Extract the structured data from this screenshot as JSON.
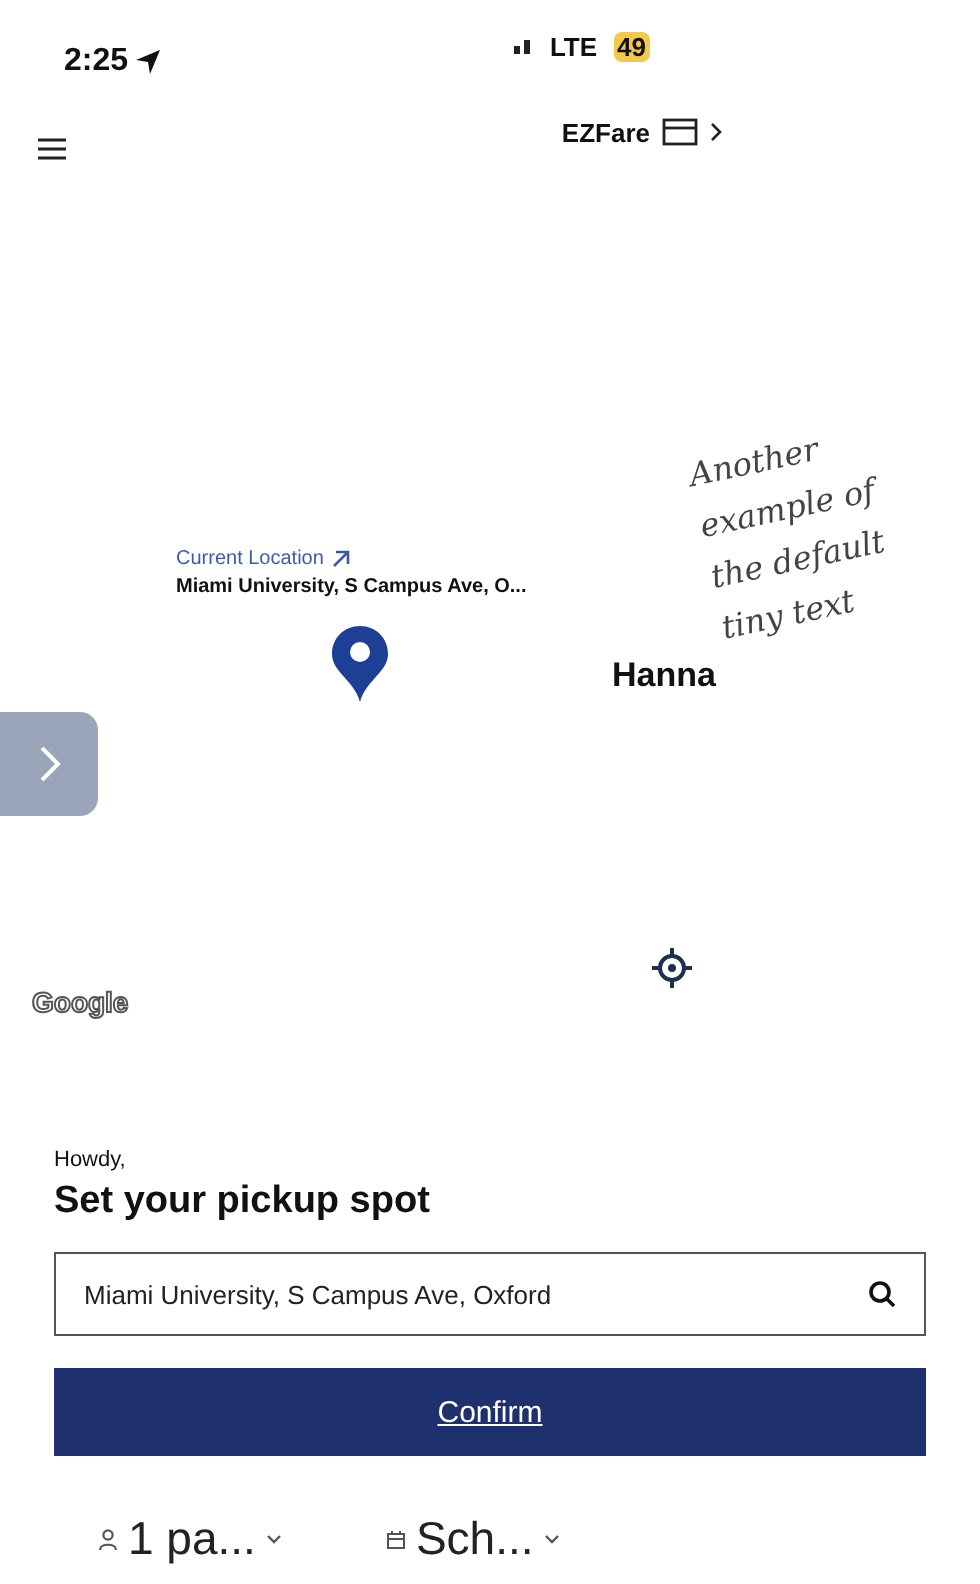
{
  "status_bar": {
    "time": "2:25",
    "network": "LTE",
    "battery": "49"
  },
  "header": {
    "fare_label": "EZFare"
  },
  "map": {
    "location_title": "Current Location",
    "location_address": "Miami University, S Campus Ave, O...",
    "place_label": "Hanna",
    "attribution": "Google"
  },
  "annotation": "Another example of the default tiny text",
  "sheet": {
    "greeting": "Howdy,",
    "title": "Set your pickup spot",
    "search_value": "Miami University, S Campus Ave, Oxford",
    "confirm": "Confirm",
    "options": [
      {
        "kind": "passengers",
        "label": "1 pa..."
      },
      {
        "kind": "schedule",
        "label": "Sch..."
      }
    ]
  }
}
